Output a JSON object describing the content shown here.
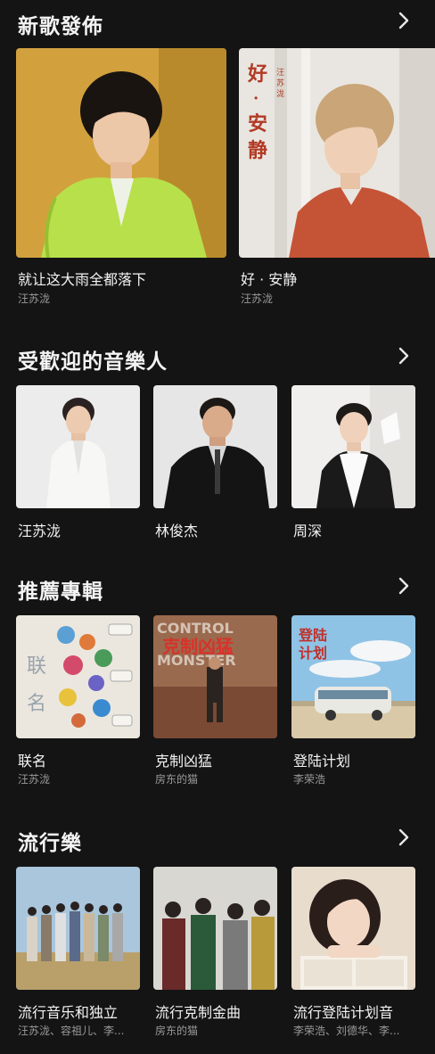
{
  "sections": {
    "new_releases": {
      "title": "新歌發佈",
      "items": [
        {
          "title": "就让这大雨全都落下",
          "artist": "汪苏泷"
        },
        {
          "title": "好 · 安静",
          "artist": "汪苏泷",
          "cover_text": "好·安静",
          "cover_small": "汪苏泷"
        }
      ]
    },
    "popular_artists": {
      "title": "受歡迎的音樂人",
      "items": [
        {
          "name": "汪苏泷"
        },
        {
          "name": "林俊杰"
        },
        {
          "name": "周深"
        }
      ]
    },
    "recommended_albums": {
      "title": "推薦專輯",
      "items": [
        {
          "title": "联名",
          "artist": "汪苏泷",
          "cover_text": "联名"
        },
        {
          "title": "克制凶猛",
          "artist": "房东的猫",
          "cover_text": "克制凶猛",
          "cover_sub": "CONTROL MONSTER"
        },
        {
          "title": "登陆计划",
          "artist": "李荣浩",
          "cover_text": "登陆计划"
        }
      ]
    },
    "pop": {
      "title": "流行樂",
      "items": [
        {
          "title": "流行音乐和独立",
          "artist": "汪苏泷、容祖儿、李..."
        },
        {
          "title": "流行克制金曲",
          "artist": "房东的猫"
        },
        {
          "title": "流行登陆计划音",
          "artist": "李荣浩、刘德华、李..."
        }
      ]
    }
  },
  "icons": {
    "chevron": "chevron-right-icon"
  },
  "colors": {
    "background": "#141414",
    "text_primary": "#f2f2f2",
    "text_secondary": "#9a9a9a"
  }
}
